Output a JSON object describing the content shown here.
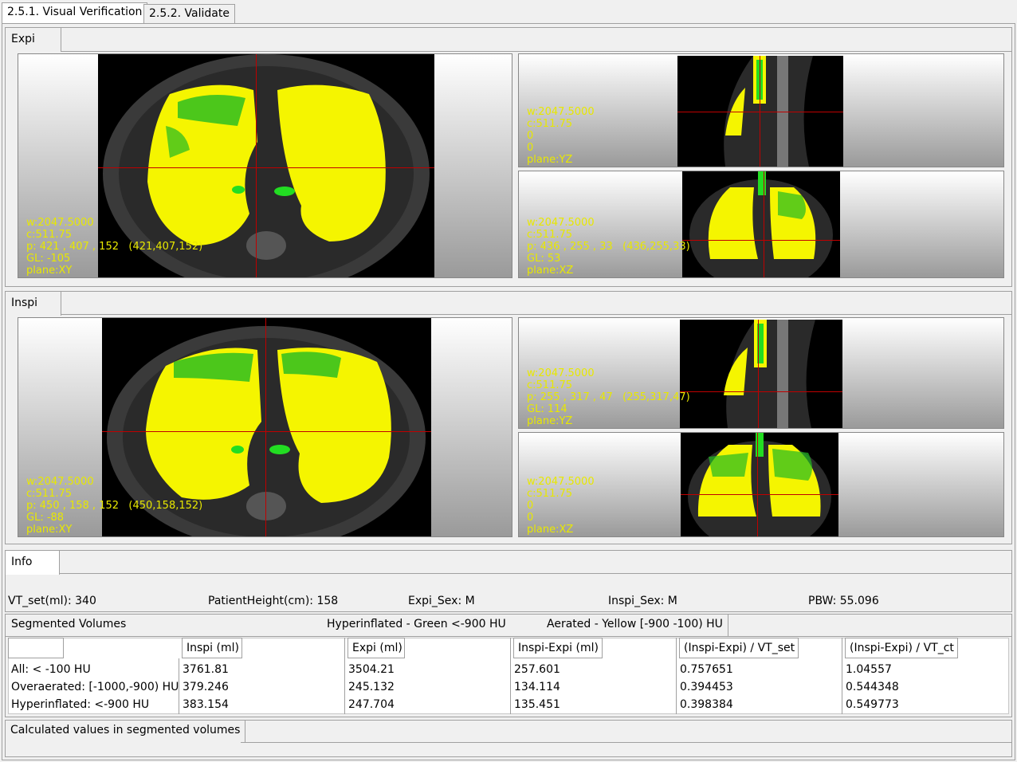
{
  "tabs": [
    {
      "label": "2.5.1. Visual Verification"
    },
    {
      "label": "2.5.2. Validate"
    }
  ],
  "expi": {
    "label": "Expi",
    "xy": {
      "lines": [
        "w:2047.5000",
        "c:511.75",
        "p: 421 , 407 , 152   (421,407,152)",
        "GL: -105",
        "plane:XY"
      ]
    },
    "yz": {
      "lines": [
        "w:2047.5000",
        "c:511.75",
        "0",
        "0",
        "plane:YZ"
      ]
    },
    "xz": {
      "lines": [
        "w:2047.5000",
        "c:511.75",
        "p: 436 , 255 , 33   (436,255,33)",
        "GL: 53",
        "plane:XZ"
      ]
    }
  },
  "inspi": {
    "label": "Inspi",
    "xy": {
      "lines": [
        "w:2047.5000",
        "c:511.75",
        "p: 450 , 158 , 152   (450,158,152)",
        "GL: -88",
        "plane:XY"
      ]
    },
    "yz": {
      "lines": [
        "w:2047.5000",
        "c:511.75",
        "p: 255 , 317 , 47   (255,317,47)",
        "GL: 114",
        "plane:YZ"
      ]
    },
    "xz": {
      "lines": [
        "w:2047.5000",
        "c:511.75",
        "0",
        "0",
        "plane:XZ"
      ]
    }
  },
  "info": {
    "label": "Info",
    "vt_set": "VT_set(ml): 340",
    "height": "PatientHeight(cm): 158",
    "expi_sex": "Expi_Sex: M",
    "inspi_sex": "Inspi_Sex: M",
    "pbw": "PBW: 55.096"
  },
  "volumes": {
    "title": "Segmented Volumes",
    "legend_green": "Hyperinflated - Green <-900 HU",
    "legend_yellow": "Aerated - Yellow [-900 -100) HU",
    "columns": [
      "Inspi (ml)",
      "Expi (ml)",
      "Inspi-Expi (ml)",
      "(Inspi-Expi) / VT_set",
      "(Inspi-Expi) / VT_ct"
    ],
    "rows": [
      {
        "label": "All: < -100 HU",
        "values": [
          "3761.81",
          "3504.21",
          "257.601",
          "0.757651",
          "1.04557"
        ]
      },
      {
        "label": "Overaerated: [-1000,-900) HU",
        "values": [
          "379.246",
          "245.132",
          "134.114",
          "0.394453",
          "0.544348"
        ]
      },
      {
        "label": "Hyperinflated: <-900 HU",
        "values": [
          "383.154",
          "247.704",
          "135.451",
          "0.398384",
          "0.549773"
        ]
      }
    ]
  },
  "calc": {
    "label": "Calculated values in segmented volumes"
  },
  "colors": {
    "lung": "#f5f500",
    "hyper": "#22dd22",
    "crosshair": "#c00000",
    "overlay_text": "#e8e800"
  }
}
